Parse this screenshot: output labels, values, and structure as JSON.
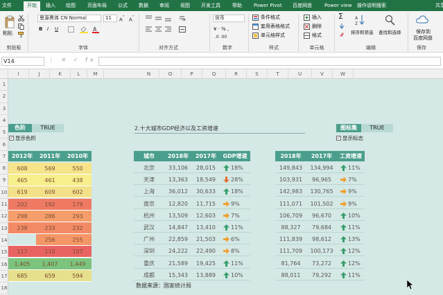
{
  "ribbon_tabs": [
    "文件",
    "开始",
    "插入",
    "绘图",
    "页面布局",
    "公式",
    "数据",
    "审阅",
    "视图",
    "开发工具",
    "帮助",
    "Power Pivot",
    "百度网盘",
    "Power view",
    "操作说明搜索",
    "共享"
  ],
  "ribbon": {
    "paste": "粘贴",
    "clipboard": "剪贴板",
    "font_name": "思源黑体 CN Normal",
    "font_size": "11",
    "font_group": "字体",
    "align_group": "对齐方式",
    "number_format": "货币",
    "number_group": "数字",
    "cond_format": "条件格式",
    "table_format": "套用表格格式",
    "cell_style": "单元格样式",
    "style_group": "样式",
    "insert": "插入",
    "delete": "删除",
    "format": "格式",
    "cells_group": "单元格",
    "sort_filter": "排序和筛选",
    "find_select": "查找和选择",
    "edit_group": "编辑",
    "save_baidu": "保存到",
    "save_baidu2": "百度网盘",
    "save_group": "保存"
  },
  "name_box": "V14",
  "columns": [
    "I",
    "J",
    "K",
    "L",
    "M",
    "N",
    "O",
    "P",
    "Q",
    "R",
    "S",
    "T",
    "U",
    "V",
    "W"
  ],
  "rows": [
    "1",
    "2",
    "3",
    "4",
    "5",
    "6",
    "7",
    "8",
    "9",
    "10",
    "11",
    "12",
    "13",
    "14",
    "15",
    "16",
    "17",
    "18"
  ],
  "colorscale": {
    "label": "色阶",
    "toggle": "TRUE",
    "checkbox": "显示色阶",
    "headers": [
      "2012年",
      "2011年",
      "2010年"
    ],
    "rows": [
      [
        "608",
        "569",
        "550"
      ],
      [
        "465",
        "461",
        "438"
      ],
      [
        "619",
        "609",
        "602"
      ],
      [
        "202",
        "192",
        "179"
      ],
      [
        "298",
        "286",
        "293"
      ],
      [
        "238",
        "233",
        "232"
      ],
      [
        "",
        "256",
        "255"
      ],
      [
        "117",
        "110",
        "107"
      ],
      [
        "1,405",
        "1,407",
        "1,449"
      ],
      [
        "685",
        "659",
        "594"
      ]
    ],
    "colors": [
      [
        "#f5e48a",
        "#f5e48a",
        "#f5e48a"
      ],
      [
        "#f7ee8c",
        "#f7ee8c",
        "#f7ee8c"
      ],
      [
        "#f3e189",
        "#f3e189",
        "#f3e189"
      ],
      [
        "#ef7a64",
        "#ef7a64",
        "#ef7a64"
      ],
      [
        "#f59e6b",
        "#f59e6b",
        "#f59e6b"
      ],
      [
        "#f38a66",
        "#f38a66",
        "#f38a66"
      ],
      [
        "#d4e8e6",
        "#f59666",
        "#f59666"
      ],
      [
        "#e86362",
        "#e86362",
        "#e86362"
      ],
      [
        "#7cc47e",
        "#7cc47e",
        "#7cc47e"
      ],
      [
        "#e6df8b",
        "#e6df8b",
        "#e6df8b"
      ]
    ]
  },
  "gdp": {
    "title": "2.十大城市GDP经济以及工资增速",
    "headers": [
      "城市",
      "2018年",
      "2017年",
      "GDP增速"
    ],
    "rows": [
      [
        "北京",
        "33,106",
        "28,015",
        "18%"
      ],
      [
        "天津",
        "13,363",
        "18,549",
        "28%"
      ],
      [
        "上海",
        "36,012",
        "30,633",
        "18%"
      ],
      [
        "南京",
        "12,820",
        "11,715",
        "9%"
      ],
      [
        "杭州",
        "13,509",
        "12,603",
        "7%"
      ],
      [
        "武汉",
        "14,847",
        "13,410",
        "11%"
      ],
      [
        "广州",
        "22,859",
        "21,503",
        "6%"
      ],
      [
        "深圳",
        "24,222",
        "22,490",
        "8%"
      ],
      [
        "重庆",
        "21,589",
        "19,425",
        "11%"
      ],
      [
        "成都",
        "15,343",
        "13,889",
        "10%"
      ]
    ],
    "icons": [
      "up",
      "down",
      "up",
      "right",
      "right",
      "up",
      "right",
      "right",
      "up",
      "up"
    ],
    "source": "数据来源：国家统计局"
  },
  "iconset": {
    "label": "图标集",
    "toggle": "TRUE",
    "checkbox": "显示标志",
    "headers": [
      "2018年",
      "2017年",
      "工资增速"
    ],
    "rows": [
      [
        "149,843",
        "134,994",
        "11%"
      ],
      [
        "103,931",
        "96,965",
        "7%"
      ],
      [
        "142,983",
        "130,765",
        "9%"
      ],
      [
        "111,071",
        "101,502",
        "9%"
      ],
      [
        "106,709",
        "96,670",
        "10%"
      ],
      [
        "88,327",
        "79,684",
        "11%"
      ],
      [
        "111,839",
        "98,612",
        "13%"
      ],
      [
        "111,709",
        "100,173",
        "12%"
      ],
      [
        "81,764",
        "73,272",
        "12%"
      ],
      [
        "88,011",
        "79,292",
        "11%"
      ]
    ],
    "icons": [
      "up",
      "right",
      "right",
      "right",
      "up",
      "up",
      "up",
      "up",
      "up",
      "up"
    ]
  },
  "colors": {
    "excel_green": "#217346",
    "header_teal": "#4a9e8c",
    "sheet_bg": "#d4e8e6",
    "icon_up": "#3a9e6c",
    "icon_right": "#f0a030",
    "icon_down": "#e07030"
  }
}
